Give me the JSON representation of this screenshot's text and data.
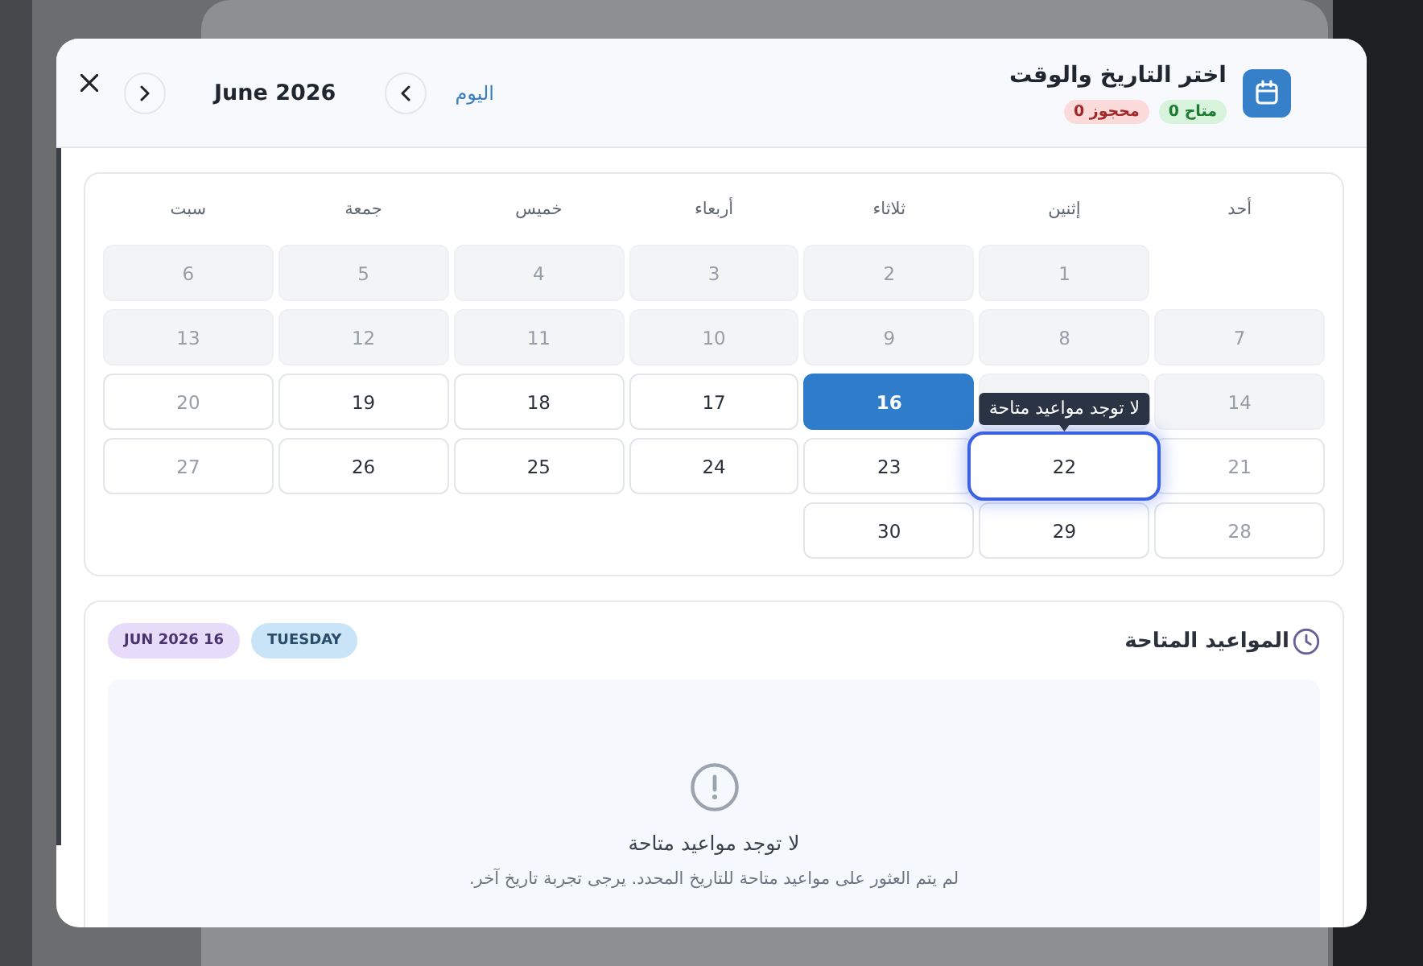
{
  "header": {
    "title": "اختر التاريخ والوقت",
    "available_badge": "0 متاح",
    "booked_badge": "0 محجوز",
    "today_link": "اليوم",
    "month": "June 2026"
  },
  "calendar": {
    "weekdays": [
      "أحد",
      "إثنين",
      "ثلاثاء",
      "أربعاء",
      "خميس",
      "جمعة",
      "سبت"
    ],
    "weeks": [
      {
        "leading_gap": true,
        "days": [
          {
            "day": "1",
            "kind": "past",
            "selected": false,
            "focused": false
          },
          {
            "day": "2",
            "kind": "past",
            "selected": false,
            "focused": false
          },
          {
            "day": "3",
            "kind": "past",
            "selected": false,
            "focused": false
          },
          {
            "day": "4",
            "kind": "past",
            "selected": false,
            "focused": false
          },
          {
            "day": "5",
            "kind": "past",
            "selected": false,
            "focused": false
          },
          {
            "day": "6",
            "kind": "past",
            "selected": false,
            "focused": false
          }
        ]
      },
      {
        "leading_gap": false,
        "days": [
          {
            "day": "7",
            "kind": "past",
            "selected": false,
            "focused": false
          },
          {
            "day": "8",
            "kind": "past",
            "selected": false,
            "focused": false
          },
          {
            "day": "9",
            "kind": "past",
            "selected": false,
            "focused": false
          },
          {
            "day": "10",
            "kind": "past",
            "selected": false,
            "focused": false
          },
          {
            "day": "11",
            "kind": "past",
            "selected": false,
            "focused": false
          },
          {
            "day": "12",
            "kind": "past",
            "selected": false,
            "focused": false
          },
          {
            "day": "13",
            "kind": "past",
            "selected": false,
            "focused": false
          }
        ]
      },
      {
        "leading_gap": false,
        "days": [
          {
            "day": "14",
            "kind": "past",
            "selected": false,
            "focused": false
          },
          {
            "kind": "past",
            "selected": false,
            "focused": false
          },
          {
            "day": "16",
            "kind": "open",
            "selected": true,
            "focused": false
          },
          {
            "day": "17",
            "kind": "open",
            "selected": false,
            "focused": false
          },
          {
            "day": "18",
            "kind": "open",
            "selected": false,
            "focused": false
          },
          {
            "day": "19",
            "kind": "open",
            "selected": false,
            "focused": false
          },
          {
            "day": "20",
            "kind": "closed",
            "selected": false,
            "focused": false
          }
        ]
      },
      {
        "leading_gap": false,
        "days": [
          {
            "day": "21",
            "kind": "closed",
            "selected": false,
            "focused": false
          },
          {
            "day": "22",
            "kind": "open",
            "selected": false,
            "focused": true,
            "tooltip": "لا توجد مواعيد متاحة"
          },
          {
            "day": "23",
            "kind": "open",
            "selected": false,
            "focused": false
          },
          {
            "day": "24",
            "kind": "open",
            "selected": false,
            "focused": false
          },
          {
            "day": "25",
            "kind": "open",
            "selected": false,
            "focused": false
          },
          {
            "day": "26",
            "kind": "open",
            "selected": false,
            "focused": false
          },
          {
            "day": "27",
            "kind": "closed",
            "selected": false,
            "focused": false
          }
        ]
      },
      {
        "leading_gap": false,
        "days": [
          {
            "day": "28",
            "kind": "closed",
            "selected": false,
            "focused": false
          },
          {
            "day": "29",
            "kind": "open",
            "selected": false,
            "focused": false
          },
          {
            "day": "30",
            "kind": "open",
            "selected": false,
            "focused": false
          }
        ]
      }
    ]
  },
  "slots": {
    "title": "المواعيد المتاحة",
    "day_badge": "TUESDAY",
    "date_badge": "JUN 2026 16",
    "empty_title": "لا توجد مواعيد متاحة",
    "empty_text": "لم يتم العثور على مواعيد متاحة للتاريخ المحدد. يرجى تجربة تاريخ آخر."
  }
}
